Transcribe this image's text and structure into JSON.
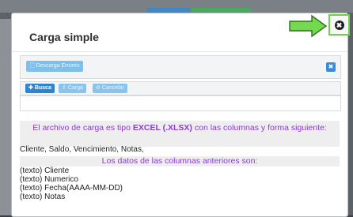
{
  "modal": {
    "title": "Carga simple",
    "close_glyph": "✖"
  },
  "toolbar": {
    "download_errors_label": "Descarga Errores",
    "dismiss_glyph": "✖",
    "search_label": "Busca",
    "upload_label": "Carga",
    "cancel_label": "Cancelar"
  },
  "info": {
    "intro_before": "El archivo de carga es tipo ",
    "intro_bold": "EXCEL (.XLSX)",
    "intro_after": " con las columnas y forma siguiente:",
    "columns_line": "Cliente, Saldo, Vencimiento, Notas,",
    "data_header": "Los datos de las columnas anteriores son:",
    "items": [
      "(texto) Cliente",
      "(texto) Numerico",
      "(texto) Fecha(AAAA-MM-DD)",
      "(texto) Notas"
    ]
  },
  "colors": {
    "accent_purple": "#8a3bd1",
    "primary_blue": "#2e84cf",
    "highlight_green": "#6ecf4a"
  },
  "icons": [
    "close-circle-icon",
    "file-icon",
    "plus-icon",
    "upload-icon",
    "ban-icon",
    "times-icon",
    "green-arrow-icon"
  ]
}
